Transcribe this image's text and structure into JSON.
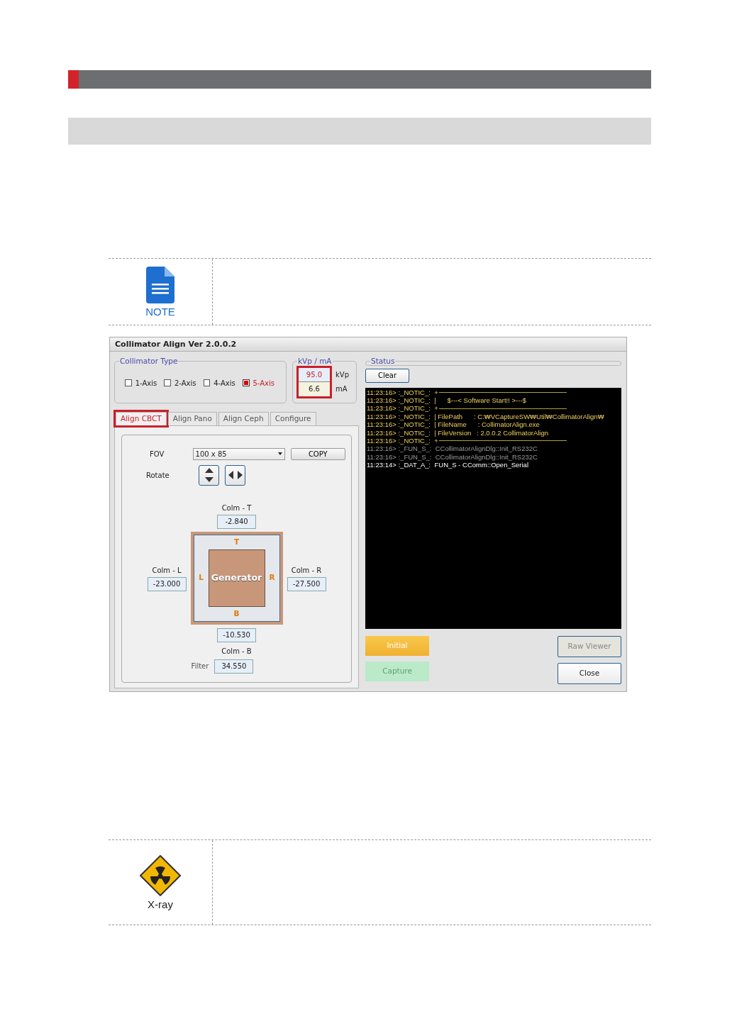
{
  "note": {
    "label": "NOTE"
  },
  "window": {
    "title": "Collimator Align  Ver 2.0.0.2"
  },
  "collimator_type": {
    "title": "Collimator Type",
    "items": [
      {
        "label": "1-Axis",
        "checked": false
      },
      {
        "label": "2-Axis",
        "checked": false
      },
      {
        "label": "4-Axis",
        "checked": false
      },
      {
        "label": "5-Axis",
        "checked": true
      }
    ]
  },
  "kvp_ma": {
    "title": "kVp / mA",
    "highlighted": true,
    "kvp": {
      "value": "95.0",
      "unit": "kVp"
    },
    "ma": {
      "value": "6.6",
      "unit": "mA"
    }
  },
  "tabs": [
    {
      "label": "Align CBCT",
      "selected": true,
      "highlighted": true
    },
    {
      "label": "Align Pano",
      "selected": false,
      "highlighted": false
    },
    {
      "label": "Align Ceph",
      "selected": false,
      "highlighted": false
    },
    {
      "label": "Configure",
      "selected": false,
      "highlighted": false
    }
  ],
  "align": {
    "fov_label": "FOV",
    "fov_value": "100 x 85",
    "copy_button": "COPY",
    "rotate_label": "Rotate",
    "colm_t": {
      "label": "Colm - T",
      "value": "-2.840"
    },
    "colm_l": {
      "label": "Colm - L",
      "value": "-23.000"
    },
    "colm_r": {
      "label": "Colm - R",
      "value": "-27.500"
    },
    "colm_b": {
      "label": "Colm - B",
      "value": "-10.530"
    },
    "filter": {
      "label": "Filter",
      "value": "34.550"
    },
    "generator": {
      "center": "Generator",
      "top": "T",
      "bottom": "B",
      "left": "L",
      "right": "R"
    }
  },
  "status": {
    "title": "Status",
    "clear_button": "Clear",
    "log": [
      {
        "kind": "notice",
        "text": "11:23:16> :_NOTIC_:  +",
        "rule": true
      },
      {
        "kind": "notice",
        "text": "11:23:16> :_NOTIC_:  |      $---< Software Start!! >---$",
        "rule": false
      },
      {
        "kind": "notice",
        "text": "11:23:16> :_NOTIC_:  +",
        "rule": true
      },
      {
        "kind": "notice",
        "text": "11:23:16> :_NOTIC_:  | FilePath      : C:₩VCaptureSW₩Util₩CollimatorAlign₩",
        "rule": false
      },
      {
        "kind": "notice",
        "text": "11:23:16> :_NOTIC_:  | FileName      : CollimatorAlign.exe",
        "rule": false
      },
      {
        "kind": "notice",
        "text": "11:23:16> :_NOTIC_:  | FileVersion   : 2.0.0.2 CollimatorAlign",
        "rule": false
      },
      {
        "kind": "notice",
        "text": "11:23:16> :_NOTIC_:  +",
        "rule": true
      },
      {
        "kind": "function",
        "text": "11:23:16> :_FUN_S_:  CCollimatorAlignDlg::Init_RS232C",
        "rule": false
      },
      {
        "kind": "function",
        "text": "11:23:16> :_FUN_S_:  CCollimatorAlignDlg::Init_RS232C",
        "rule": false
      },
      {
        "kind": "data",
        "text": "11:23:14> :_DAT_A_:  FUN_S - CComm::Open_Serial",
        "rule": false
      }
    ]
  },
  "buttons": [
    {
      "label": "Initial",
      "kind": "warning",
      "disabled": false
    },
    {
      "label": "Raw Viewer",
      "kind": "plain",
      "disabled": true
    },
    {
      "label": "Capture",
      "kind": "success",
      "disabled": true
    },
    {
      "label": "Close",
      "kind": "plain",
      "disabled": false
    }
  ],
  "xray": {
    "label": "X-ray"
  }
}
